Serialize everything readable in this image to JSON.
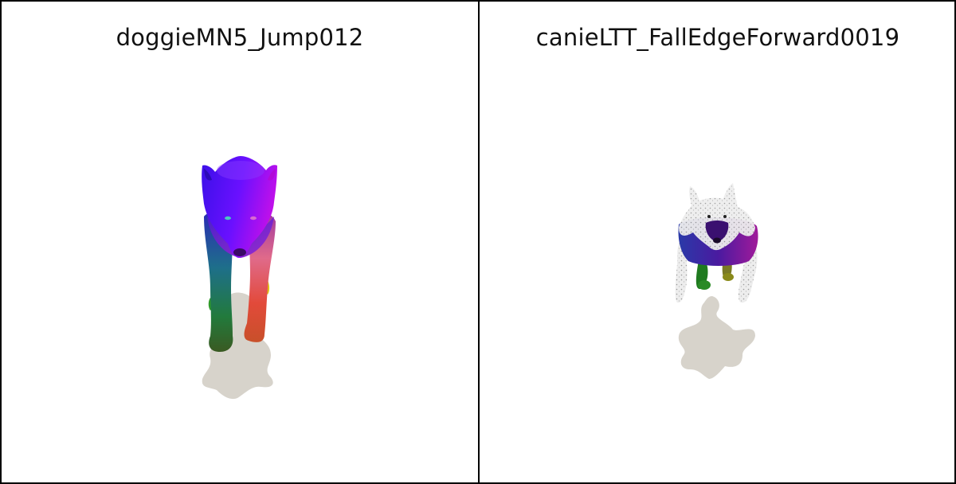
{
  "panels": [
    {
      "title": "doggieMN5_Jump012",
      "shadow_color": "#d7d3cb"
    },
    {
      "title": "canieLTT_FallEdgeForward0019",
      "shadow_color": "#d7d3cb"
    }
  ]
}
